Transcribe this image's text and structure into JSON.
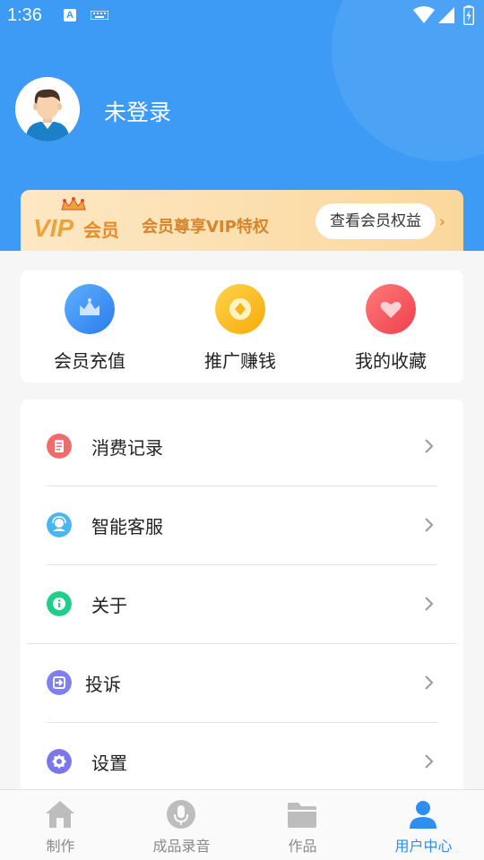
{
  "status_bar": {
    "time": "1:36",
    "icons": [
      "a-notification-icon",
      "keyboard-icon",
      "wifi-icon",
      "cell-signal-icon",
      "battery-icon"
    ]
  },
  "profile": {
    "name": "未登录",
    "avatar_icon": "avatar-icon"
  },
  "vip_banner": {
    "logo_text_vip": "VIP",
    "logo_text_member": "会员",
    "slogan": "会员尊享VIP特权",
    "button_label": "查看会员权益",
    "arrow": "›"
  },
  "quick_actions": [
    {
      "label": "会员充值",
      "icon": "crown-icon",
      "color": "#3b8ff5"
    },
    {
      "label": "推广赚钱",
      "icon": "coin-icon",
      "color": "#fbbf16"
    },
    {
      "label": "我的收藏",
      "icon": "heart-icon",
      "color": "#f2545b"
    }
  ],
  "menu": [
    {
      "label": "消费记录",
      "icon": "receipt-icon",
      "color": "#f36a6a"
    },
    {
      "label": "智能客服",
      "icon": "customer-service-icon",
      "color": "#49b5f1"
    },
    {
      "label": "关于",
      "icon": "info-icon",
      "color": "#1dcf8a"
    },
    {
      "label": "投诉",
      "icon": "complaint-icon",
      "color": "#7e80f2"
    },
    {
      "label": "设置",
      "icon": "settings-icon",
      "color": "#7b76ec"
    }
  ],
  "tab_bar": {
    "active": "用户中心",
    "tabs": [
      {
        "label": "制作",
        "icon": "home-icon"
      },
      {
        "label": "成品录音",
        "icon": "microphone-icon"
      },
      {
        "label": "作品",
        "icon": "folder-icon"
      },
      {
        "label": "用户中心",
        "icon": "user-icon"
      }
    ]
  },
  "colors": {
    "header_blue": "#3d9bf5",
    "active_tab": "#2f8ef0",
    "vip_gold": "#d5852c"
  }
}
